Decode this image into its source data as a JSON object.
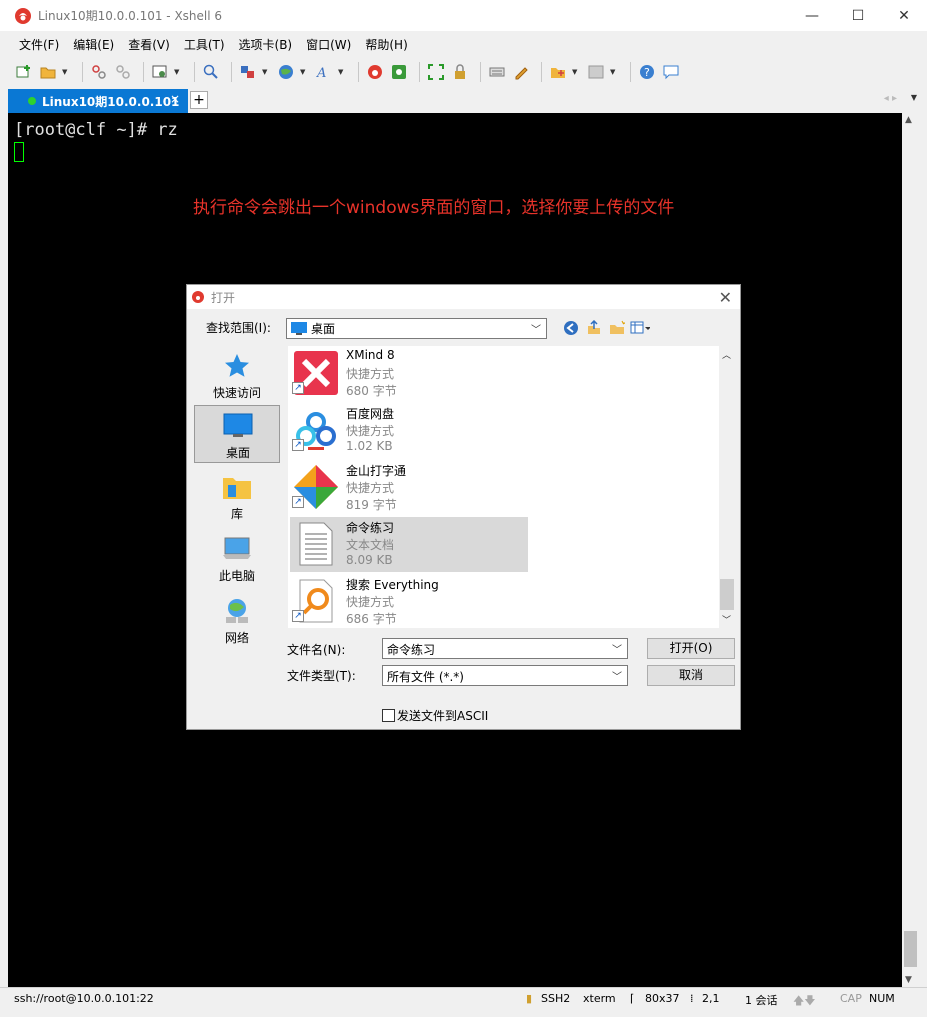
{
  "titlebar": {
    "title": "Linux10期10.0.0.101 - Xshell 6",
    "minimize": "—",
    "maximize": "☐",
    "close": "✕"
  },
  "menu": [
    "文件(F)",
    "编辑(E)",
    "查看(V)",
    "工具(T)",
    "选项卡(B)",
    "窗口(W)",
    "帮助(H)"
  ],
  "tabs": {
    "active_label": "Linux10期10.0.0.101",
    "close": "×",
    "add": "+",
    "arrows": "◂ ▸",
    "menu": "▼"
  },
  "terminal": {
    "prompt_line": "[root@clf ~]# rz",
    "annotation": "执行命令会跳出一个windows界面的窗口，选择你要上传的文件"
  },
  "statusbar": {
    "connection": "ssh://root@10.0.0.101:22",
    "protocol": "SSH2",
    "terminal_type": "xterm",
    "size": "80x37",
    "position": "2,1",
    "sessions": "1 会话",
    "cap": "CAP",
    "num": "NUM"
  },
  "dialog": {
    "title": "打开",
    "close": "✕",
    "lookin_label": "查找范围(I):",
    "lookin_value": "桌面",
    "places": [
      "快速访问",
      "桌面",
      "库",
      "此电脑",
      "网络"
    ],
    "files": [
      {
        "name": "XMind 8",
        "type": "快捷方式",
        "size": "680 字节"
      },
      {
        "name": "百度网盘",
        "type": "快捷方式",
        "size": "1.02 KB"
      },
      {
        "name": "金山打字通",
        "type": "快捷方式",
        "size": "819 字节"
      },
      {
        "name": "命令练习",
        "type": "文本文档",
        "size": "8.09 KB"
      },
      {
        "name": "搜索 Everything",
        "type": "快捷方式",
        "size": "686 字节"
      }
    ],
    "filename_label": "文件名(N):",
    "filename_value": "命令练习",
    "filetype_label": "文件类型(T):",
    "filetype_value": "所有文件 (*.*)",
    "open_button": "打开(O)",
    "cancel_button": "取消",
    "ascii_label": "发送文件到ASCII"
  }
}
